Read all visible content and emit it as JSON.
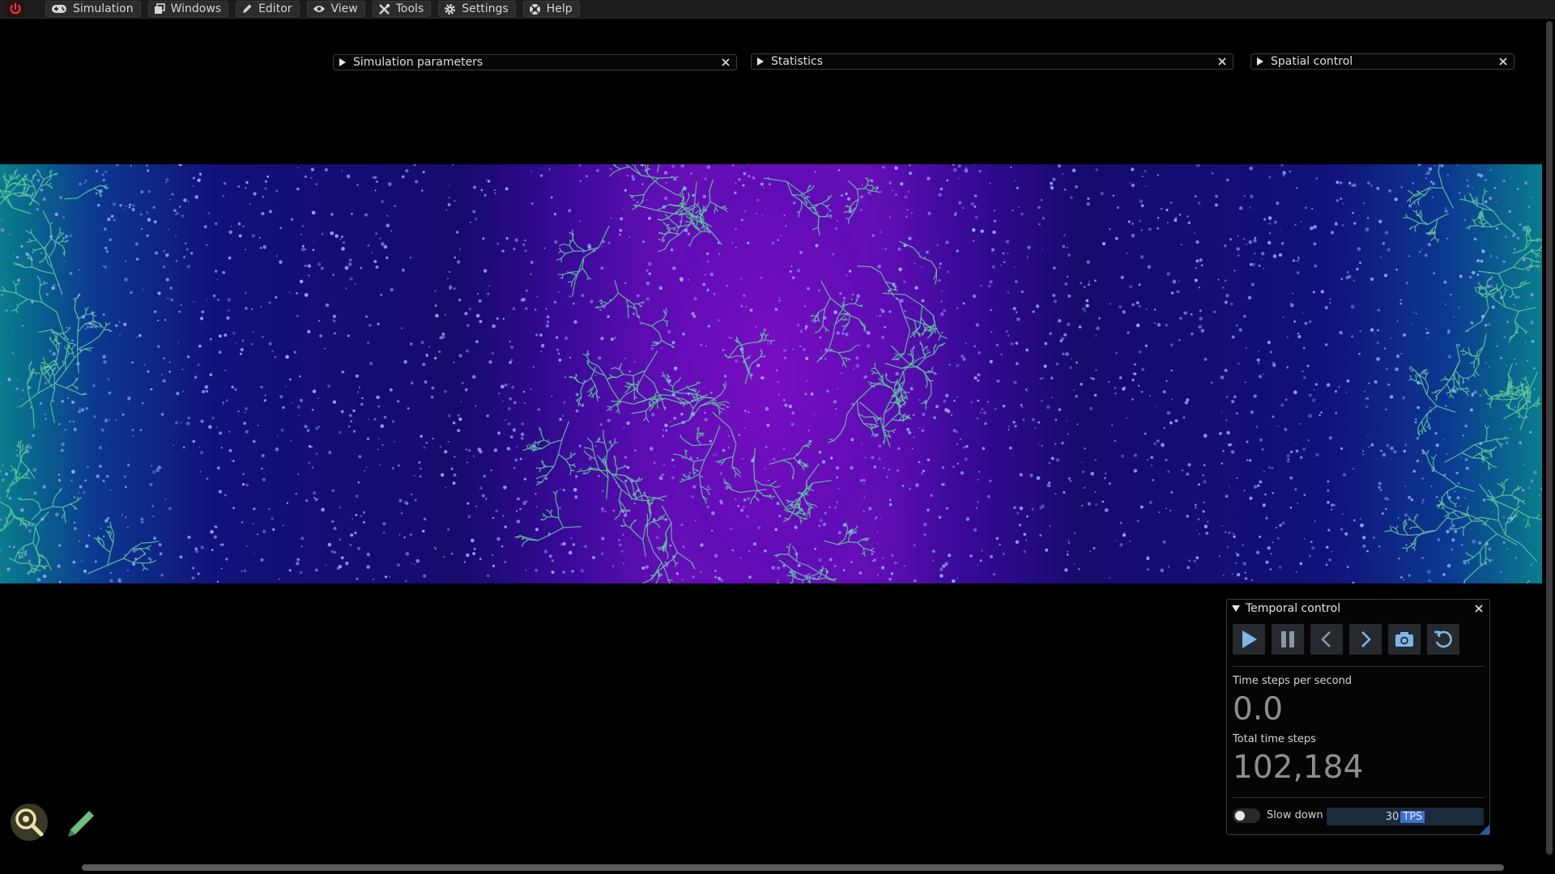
{
  "menubar": {
    "power_icon": "power-icon",
    "items": [
      {
        "label": "Simulation",
        "icon": "gamepad-icon"
      },
      {
        "label": "Windows",
        "icon": "windows-icon"
      },
      {
        "label": "Editor",
        "icon": "pencil-icon"
      },
      {
        "label": "View",
        "icon": "eye-icon"
      },
      {
        "label": "Tools",
        "icon": "tools-icon"
      },
      {
        "label": "Settings",
        "icon": "gear-icon"
      },
      {
        "label": "Help",
        "icon": "help-icon"
      }
    ]
  },
  "windows": {
    "simulation_parameters": {
      "title": "Simulation parameters",
      "collapsed": true
    },
    "statistics": {
      "title": "Statistics",
      "collapsed": true
    },
    "spatial_control": {
      "title": "Spatial control",
      "collapsed": true
    }
  },
  "temporal_control": {
    "title": "Temporal control",
    "buttons": [
      "play-icon",
      "pause-icon",
      "step-back-icon",
      "step-forward-icon",
      "snapshot-icon",
      "restore-icon"
    ],
    "tps_label": "Time steps per second",
    "tps_value": "0.0",
    "total_label": "Total time steps",
    "total_value": "102,184",
    "slow_down_label": "Slow down",
    "slow_down_enabled": false,
    "slider_value": "30",
    "slider_unit": "TPS"
  },
  "tools": {
    "inspect_icon": "inspect-icon",
    "editor_icon": "pencil-icon"
  },
  "colors": {
    "background": "#000000",
    "menubar": "#1c1c1c",
    "accent": "#3f72c4",
    "particles": "#9aa6ff",
    "structures": "#5fc79b"
  }
}
